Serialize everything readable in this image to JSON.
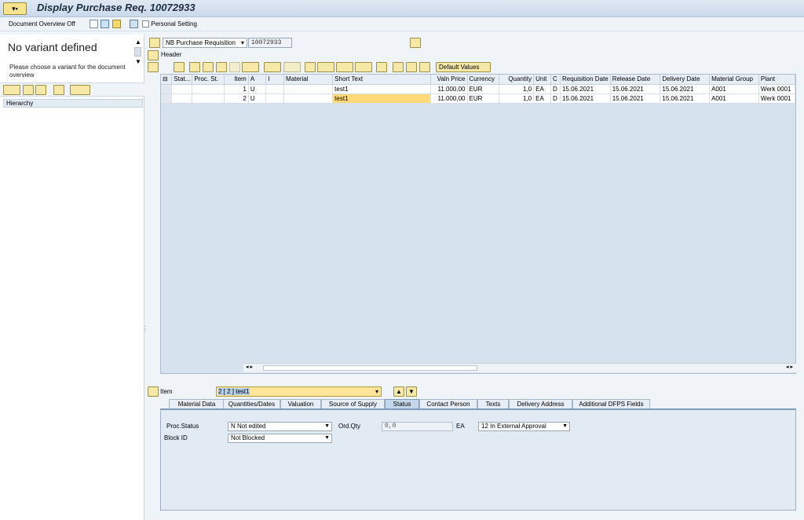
{
  "title_bar": {
    "title": "Display Purchase Req. 10072933"
  },
  "app_toolbar": {
    "doc_overview": "Document Overview Off",
    "personal_setting": "Personal Setting"
  },
  "left_pane": {
    "variant_title": "No variant defined",
    "variant_hint": "Please choose a variant for the document overview",
    "hierarchy": "Hierarchy"
  },
  "header": {
    "doc_type": "NB Purchase Requisition",
    "doc_number": "10072933",
    "header_label": "Header"
  },
  "grid_toolbar": {
    "default_values": "Default Values"
  },
  "grid": {
    "columns": [
      "Stat...",
      "Proc. St.",
      "Item",
      "A",
      "I",
      "Material",
      "Short Text",
      "Valn Price",
      "Currency",
      "Quantity",
      "Unit",
      "C",
      "Requisition Date",
      "Release Date",
      "Delivery Date",
      "Material Group",
      "Plant"
    ],
    "rows": [
      [
        "",
        "",
        "1",
        "U",
        "",
        "",
        "test1",
        "11.000,00",
        "EUR",
        "1,0",
        "EA",
        "D",
        "15.06.2021",
        "15.06.2021",
        "15.06.2021",
        "A001",
        "Werk 0001"
      ],
      [
        "",
        "",
        "2",
        "U",
        "",
        "",
        "test1",
        "11.000,00",
        "EUR",
        "1,0",
        "EA",
        "D",
        "15.06.2021",
        "15.06.2021",
        "15.06.2021",
        "A001",
        "Werk 0001"
      ]
    ]
  },
  "item_detail": {
    "item_label": "Item",
    "item_value": "2 [ 2 ] test1",
    "tabs": [
      "Material Data",
      "Quantities/Dates",
      "Valuation",
      "Source of Supply",
      "Status",
      "Contact Person",
      "Texts",
      "Delivery Address",
      "Additional DFPS Fields"
    ],
    "active_tab": "Status",
    "fields": {
      "proc_status_label": "Proc.Status",
      "proc_status_value": "N Not edited",
      "ord_qty_label": "Ord.Qty",
      "ord_qty_value": "0,0",
      "ord_qty_unit": "EA",
      "approval_value": "12 In External Approval",
      "block_id_label": "Block ID",
      "block_id_value": "Not Blocked"
    }
  }
}
